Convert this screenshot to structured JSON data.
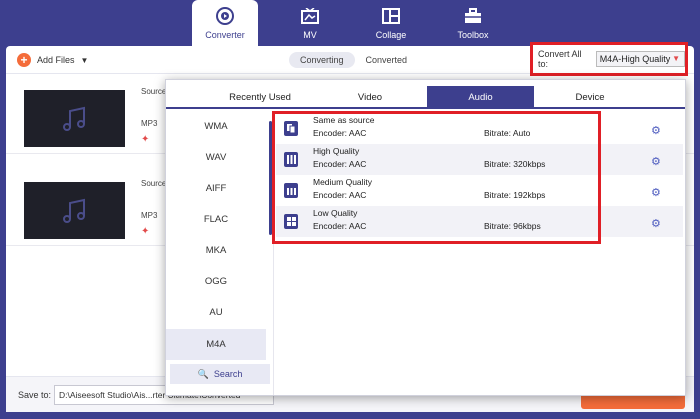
{
  "nav": {
    "tabs": [
      {
        "label": "Converter",
        "icon": "converter-icon"
      },
      {
        "label": "MV",
        "icon": "mv-icon"
      },
      {
        "label": "Collage",
        "icon": "collage-icon"
      },
      {
        "label": "Toolbox",
        "icon": "toolbox-icon"
      }
    ]
  },
  "toolbar": {
    "add_files_label": "Add Files",
    "converting_label": "Converting",
    "converted_label": "Converted",
    "convert_all_label": "Convert All to:",
    "convert_all_value": "M4A-High Quality"
  },
  "files": [
    {
      "source_label": "Source",
      "format": "MP3"
    },
    {
      "source_label": "Source",
      "format": "MP3"
    }
  ],
  "popup": {
    "tabs": [
      "Recently Used",
      "Video",
      "Audio",
      "Device"
    ],
    "formats": [
      "WMA",
      "WAV",
      "AIFF",
      "FLAC",
      "MKA",
      "OGG",
      "AU",
      "M4A"
    ],
    "search_label": "Search",
    "presets": [
      {
        "name": "Same as source",
        "encoder": "Encoder: AAC",
        "bitrate": "Bitrate: Auto"
      },
      {
        "name": "High Quality",
        "encoder": "Encoder: AAC",
        "bitrate": "Bitrate: 320kbps"
      },
      {
        "name": "Medium Quality",
        "encoder": "Encoder: AAC",
        "bitrate": "Bitrate: 192kbps"
      },
      {
        "name": "Low Quality",
        "encoder": "Encoder: AAC",
        "bitrate": "Bitrate: 96kbps"
      }
    ]
  },
  "bottombar": {
    "save_label": "Save to:",
    "save_path": "D:\\Aiseesoft Studio\\Ais...rter Ultimate\\Converted"
  },
  "colors": {
    "brand": "#3d3f8e",
    "accent": "#f46c3a",
    "highlight_box": "#e01f26"
  }
}
